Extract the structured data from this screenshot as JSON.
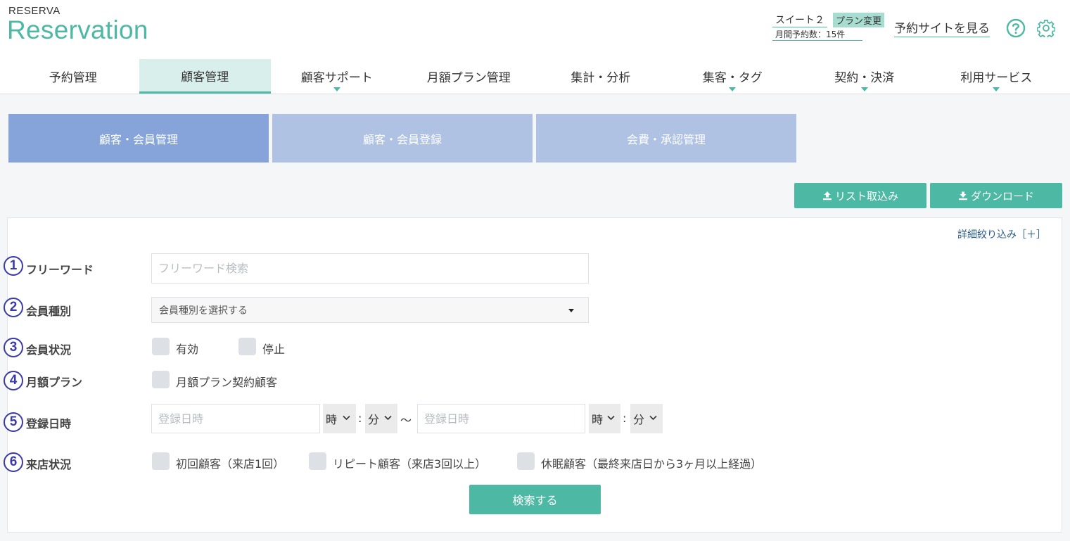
{
  "header": {
    "logo_small": "RESERVA",
    "logo_big": "Reservation",
    "plan_name": "スイート２",
    "plan_change": "プラン変更",
    "monthly_count": "月間予約数：15件",
    "site_link": "予約サイトを見る",
    "help_icon": "question-circle-icon",
    "gear_icon": "gear-icon",
    "accent_color": "#4db8a4"
  },
  "nav": {
    "items": [
      {
        "label": "予約管理"
      },
      {
        "label": "顧客管理"
      },
      {
        "label": "顧客サポート"
      },
      {
        "label": "月額プラン管理"
      },
      {
        "label": "集計・分析"
      },
      {
        "label": "集客・タグ"
      },
      {
        "label": "契約・決済"
      },
      {
        "label": "利用サービス"
      }
    ]
  },
  "subtabs": [
    "顧客・会員管理",
    "顧客・会員登録",
    "会費・承認管理"
  ],
  "actions": {
    "import_label": "リスト取込み",
    "download_label": "ダウンロード"
  },
  "search": {
    "detail_toggle": "詳細絞り込み［＋］",
    "rows": [
      {
        "num": "1",
        "label": "フリーワード",
        "placeholder": "フリーワード検索"
      },
      {
        "num": "2",
        "label": "会員種別",
        "select_value": "会員種別を選択する"
      },
      {
        "num": "3",
        "label": "会員状況",
        "options": [
          "有効",
          "停止"
        ]
      },
      {
        "num": "4",
        "label": "月額プラン",
        "options": [
          "月額プラン契約顧客"
        ]
      },
      {
        "num": "5",
        "label": "登録日時",
        "date_placeholder": "登録日時",
        "hour": "時",
        "minute": "分",
        "colon": ":",
        "tilde": "〜"
      },
      {
        "num": "6",
        "label": "来店状況",
        "options": [
          "初回顧客（来店1回）",
          "リピート顧客（来店3回以上）",
          "休眠顧客（最終来店日から3ヶ月以上経過）"
        ]
      }
    ],
    "submit_label": "検索する"
  }
}
